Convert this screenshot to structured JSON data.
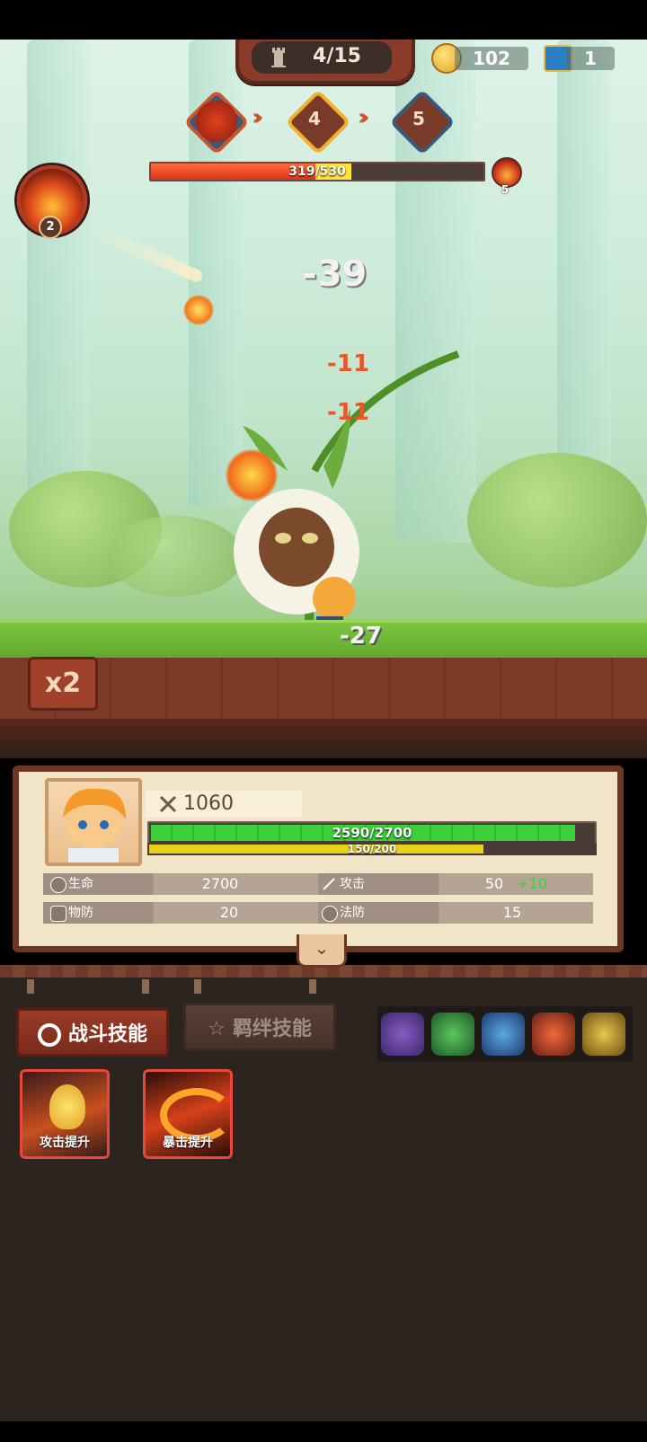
{
  "wave": {
    "current": "4/15"
  },
  "currency": {
    "coins": "102",
    "chests": "1"
  },
  "stages": {
    "next": "4",
    "after": "5"
  },
  "boss": {
    "hp_text": "319/530",
    "hp_fraction": 0.602,
    "fire_stacks": "5"
  },
  "fire_skill": {
    "level": "2"
  },
  "damage": {
    "big": "-39",
    "hit1": "-11",
    "hit2": "-11",
    "hero_hit": "-27"
  },
  "speed": {
    "label": "x2"
  },
  "hero": {
    "power": "1060",
    "hp_text": "2590/2700",
    "hp_fraction": 0.959,
    "exp_text": "150/200",
    "exp_fraction": 0.75,
    "stats": {
      "hp_label": "生命",
      "hp_value": "2700",
      "atk_label": "攻击",
      "atk_value": "50",
      "atk_bonus": "+10",
      "pdef_label": "物防",
      "pdef_value": "20",
      "mdef_label": "法防",
      "mdef_value": "15"
    }
  },
  "tabs": {
    "battle": "战斗技能",
    "bond": "羁绊技能"
  },
  "skills": [
    {
      "label": "攻击提升"
    },
    {
      "label": "暴击提升"
    }
  ],
  "colors": {
    "accent": "#e8473c",
    "hp": "#3bd03a",
    "boss_hp": "#d8361c"
  }
}
